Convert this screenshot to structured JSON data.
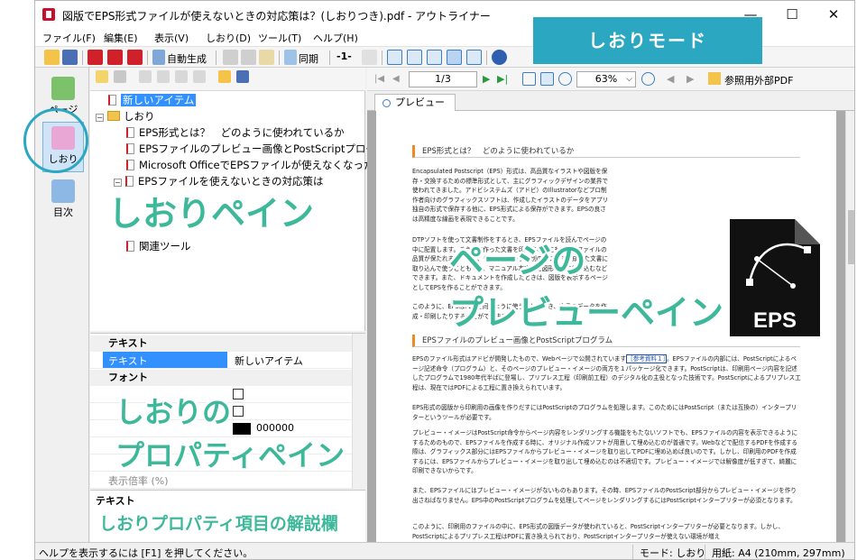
{
  "window": {
    "title": "図版でEPS形式ファイルが使えないときの対応策は？(しおりつき).pdf - アウトライナー",
    "minimize": "—",
    "maximize": "☐",
    "close": "✕"
  },
  "menu": [
    "ファイル(F)",
    "編集(E)",
    "表示(V)",
    "しおり(D)",
    "ツール(T)",
    "ヘルプ(H)"
  ],
  "toolbar": {
    "auto_generate": "自動生成",
    "sync": "同期",
    "page_indicator": "-1-"
  },
  "mode_banner": "しおりモード",
  "mode_buttons": {
    "page": "ページ",
    "bookmark": "しおり",
    "toc": "目次"
  },
  "bookmarks": {
    "new_item": "新しいアイテム",
    "folder": "しおり",
    "items": [
      "EPS形式とは？　どのように使われているか",
      "EPSファイルのプレビュー画像とPostScriptプログラム",
      "Microsoft OfficeでEPSファイルが使えなくなった",
      "EPSファイルを使えないときの対応策は"
    ],
    "related": "関連ツール"
  },
  "properties": {
    "cat_text": "テキスト",
    "text_key": "テキスト",
    "text_value": "新しいアイテム",
    "cat_font": "フォント",
    "color_value": "000000",
    "zoom_key": "表示倍率 (%)"
  },
  "description": {
    "title": "テキスト"
  },
  "preview": {
    "page_box": "1/3",
    "zoom": "63%",
    "external_pdf": "参照用外部PDF",
    "tab_label": "プレビュー"
  },
  "document": {
    "heading1": "EPS形式とは？　どのように使われているか",
    "p1": "Encapsulated Postscript（EPS）形式は、高品質なイラストや図版を保存・交換するための標準形式として、主にグラフィックデザインの業界で使われてきました。アドビシステムズ（アドビ）のIllustratorなどプロ制作者向けのグラフィックスソフトは、作成したイラストのデータをアプリ独自の形式で保存する他に、EPS形式による保存ができます。EPSの良さは高精度な線画を表現できることです。",
    "p2": "DTPソフトを使って文書制作をするとき、EPSファイルを読んでページの中に配置します。こうして作った文書を印刷する際にも、EPSファイルの品質が保たれます。また、作成したデータを別のソフトで作成した文書に取り込んで使うこともでき、マニュアル本文中に図形として組み込むなどできます。また、ドキュメントを作成したときは、図版を表示するページとしてEPSを作ることができます。",
    "p3": "このように、EPSはPDFと同じように使うことができ、文書のデータを作成・印刷したりすることができます。",
    "heading2": "EPSファイルのプレビュー画像とPostScriptプログラム",
    "p4_a": "EPSのファイル形式はアドビが開発したもので、Webページで公開されています",
    "p4_link": "［参考資料１］",
    "p4_b": "。EPSファイルの内部には、PostScriptによるページ記述命令（プログラム）と、そのページのプレビュー・イメージの両方を１パッケージ化できます。PostScriptは、印刷用ページ内容を記述したプログラムで1980年代半ばに登場し、プリプレス工程（印刷前工程）のデジタル化の主役となった技術です。PostScriptによるプリプレス工程は、現在ではPDFによる工程に置き換えられています。",
    "p5": "EPS形式の図版から印刷用の画像を作りだすにはPostScriptのプログラムを処理します。このためにはPostScript（または互換の）インタープリターというツールが必要です。",
    "p6": "プレビュー・イメージはPostScript命令からページ内容をレンダリングする機能をもたないソフトでも、EPSファイルの内容を表示できるようにするためのもので、EPSファイルを作成する時に、オリジナル作成ソフトが用意して埋め込むのが普通です。Webなどで配信するPDFを作成する際は、グラフィックス部分にはEPSファイルからプレビュー・イメージを取り出してPDFに埋め込めば良いのです。しかし、印刷用のPDFを作成するには、EPSファイルからプレビュー・イメージを取り出して埋め込むのは不適切です。プレビュー・イメージでは解像度が低すぎて、綺麗に印刷できないからです。",
    "p7": "また、EPSファイルにはプレビュー・イメージがないものもあります。その時、EPSファイルのPostScript部分からプレビュー・イメージを作り出さねばなりません。EPS中のPostScriptプログラムを処理してページをレンダリングするにはPostScriptインタープリターが必須となります。",
    "p8": "このように、印刷用のファイルの中に、EPS形式の図版データが使われていると、PostScriptインタープリターが必要となります。しかし、PostScriptによるプリプレス工程はPDFに置き換えられており、PostScriptインタープリターが使えない環境が増え",
    "eps_badge": "EPS"
  },
  "status": {
    "help": "ヘルプを表示するには [F1] を押してください。",
    "mode": "モード: しおり",
    "paper": "用紙: A4 (210mm, 297mm)"
  },
  "annotations": {
    "bookmark_pane": "しおりペイン",
    "preview_pane_line1": "ページの",
    "preview_pane_line2": "プレビューペイン",
    "property_pane_line1": "しおりの",
    "property_pane_line2": "プロパティペイン",
    "description_pane": "しおりプロパティ項目の解説欄"
  },
  "colors": {
    "accent": "#2ba7c2",
    "annotation": "#3eb89a",
    "heading_bar": "#f08a24",
    "selection": "#3390ff"
  }
}
